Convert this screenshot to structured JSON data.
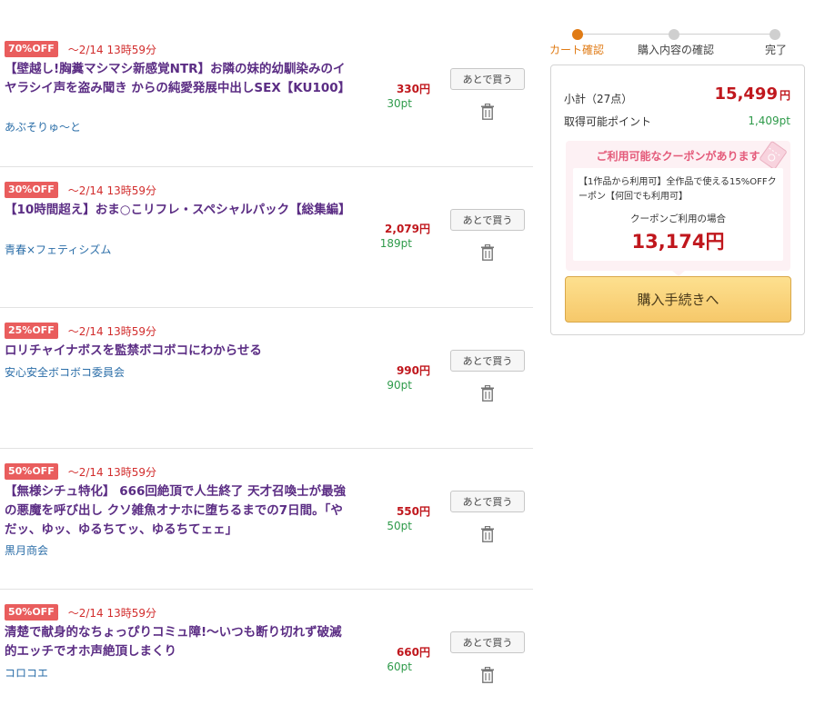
{
  "cart": {
    "later_label": "あとで買う",
    "items": [
      {
        "discount": "70%OFF",
        "deadline": "〜2/14 13時59分",
        "title": "【壁越し!胸糞マシマシ新感覚NTR】お隣の妹的幼馴染みのイヤラシイ声を盗み聞き からの純愛発展中出しSEX【KU100】",
        "circle": "あぶそりゅ〜と",
        "price": "330円",
        "points": "30pt"
      },
      {
        "discount": "30%OFF",
        "deadline": "〜2/14 13時59分",
        "title": "【10時間超え】おま○こリフレ・スペシャルパック【総集編】",
        "circle": "青春×フェティシズム",
        "price": "2,079円",
        "points": "189pt"
      },
      {
        "discount": "25%OFF",
        "deadline": "〜2/14 13時59分",
        "title": "ロリチャイナボスを監禁ボコボコにわからせる",
        "circle": "安心安全ボコボコ委員会",
        "price": "990円",
        "points": "90pt"
      },
      {
        "discount": "50%OFF",
        "deadline": "〜2/14 13時59分",
        "title": "【無様シチュ特化】 666回絶頂で人生終了 天才召喚士が最強の悪魔を呼び出し クソ雑魚オナホに堕ちるまでの7日間。「やだッ、ゆッ、ゆるちてッ、ゆるちてェェ」",
        "circle": "黒月商会",
        "price": "550円",
        "points": "50pt"
      },
      {
        "discount": "50%OFF",
        "deadline": "〜2/14 13時59分",
        "title": "清楚で献身的なちょっぴりコミュ障!〜いつも断り切れず破滅的エッチでオホ声絶頂しまくり",
        "circle": "コロコエ",
        "price": "660円",
        "points": "60pt"
      }
    ]
  },
  "steps": [
    {
      "label": "カート確認",
      "active": true
    },
    {
      "label": "購入内容の確認",
      "active": false
    },
    {
      "label": "完了",
      "active": false
    }
  ],
  "summary": {
    "subtotal_label": "小計（27点）",
    "subtotal_value": "15,499",
    "yen": "円",
    "points_label": "取得可能ポイント",
    "points_value": "1,409pt"
  },
  "coupon": {
    "heading": "ご利用可能なクーポンがあります",
    "description": "【1作品から利用可】全作品で使える15%OFFクーポン【何回でも利用可】",
    "note": "クーポンご利用の場合",
    "price": "13,174円"
  },
  "checkout": {
    "label": "購入手続きへ"
  },
  "colors": {
    "discount_badge": "#e95d5d",
    "title_purple": "#5b2d84",
    "price_red": "#c0171d",
    "points_green": "#2e9a4a",
    "step_active": "#e07b15",
    "coupon_bg": "#fdf1f4",
    "checkout_yellow": "#f6c86a"
  },
  "icons": {
    "delete": "trash-icon",
    "coupon": "coupon-ticket-icon"
  }
}
